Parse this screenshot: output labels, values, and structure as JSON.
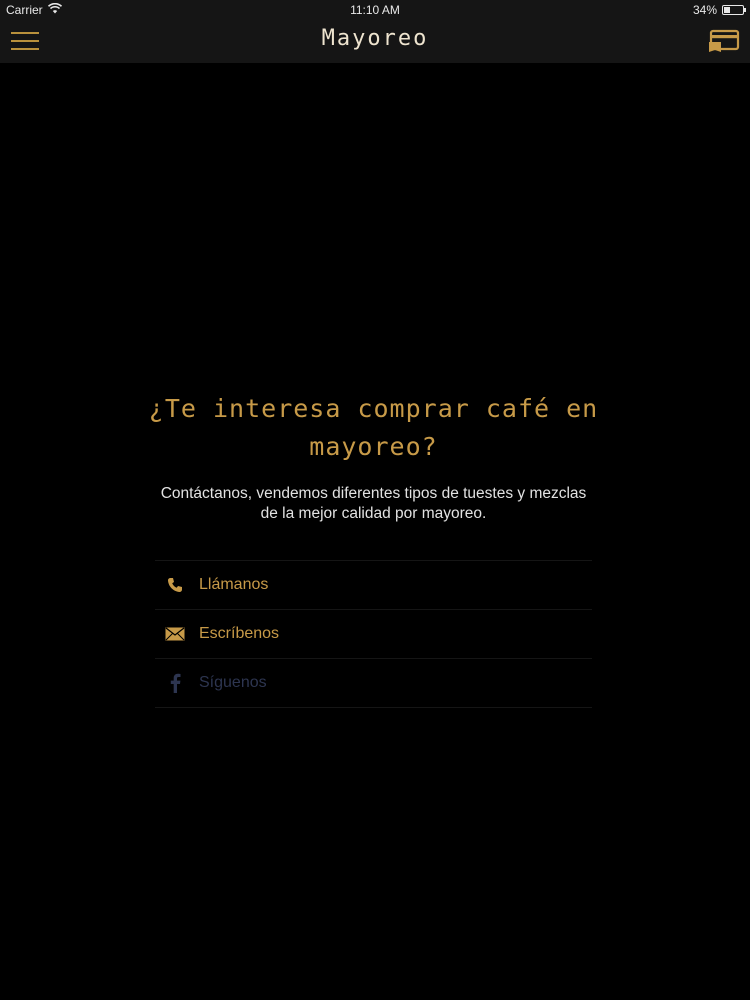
{
  "status_bar": {
    "carrier": "Carrier",
    "time": "11:10 AM",
    "battery_percent": "34%",
    "battery_level": 0.34
  },
  "nav": {
    "title": "Mayoreo",
    "menu_icon": "hamburger-menu-icon",
    "cart_icon": "cart-icon"
  },
  "main": {
    "headline": "¿Te interesa comprar café en mayoreo?",
    "description": "Contáctanos, vendemos diferentes tipos de tuestes y mezclas de la mejor calidad por mayoreo.",
    "contacts": [
      {
        "label": "Llámanos",
        "icon": "phone-icon"
      },
      {
        "label": "Escríbenos",
        "icon": "email-icon"
      },
      {
        "label": "Síguenos",
        "icon": "facebook-icon"
      }
    ]
  },
  "colors": {
    "accent": "#c79a48",
    "background": "#000000",
    "bar": "#151515",
    "muted_link": "#2d3550"
  }
}
